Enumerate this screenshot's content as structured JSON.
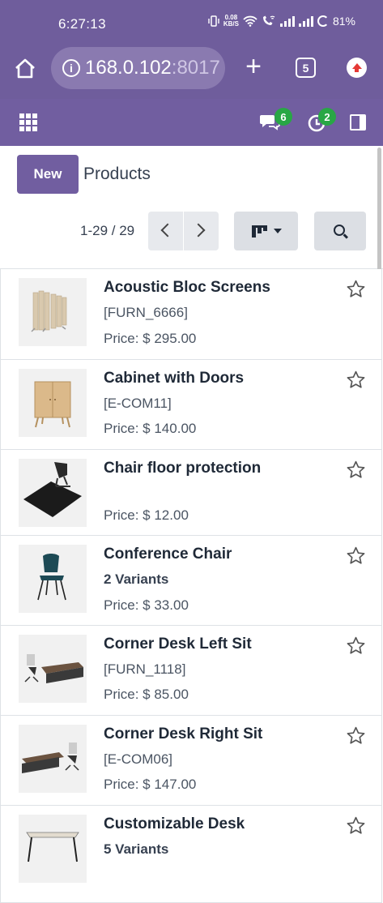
{
  "status_bar": {
    "time": "6:27:13",
    "net_speed_top": "0.08",
    "net_speed_unit": "KB/S",
    "battery": "81%"
  },
  "browser": {
    "url_host": "168.0.102",
    "url_port": ":8017",
    "tab_count": "5"
  },
  "app_bar": {
    "messages_count": "6",
    "activities_count": "2"
  },
  "control_panel": {
    "new_label": "New",
    "breadcrumb": "Products",
    "pager_value": "1-29 / 29"
  },
  "products": [
    {
      "name": "Acoustic Bloc Screens",
      "reference": "[FURN_6666]",
      "variants": "",
      "price": "Price: $ 295.00",
      "image": "screens"
    },
    {
      "name": "Cabinet with Doors",
      "reference": "[E-COM11]",
      "variants": "",
      "price": "Price: $ 140.00",
      "image": "cabinet"
    },
    {
      "name": "Chair floor protection",
      "reference": "",
      "variants": "",
      "price": "Price: $ 12.00",
      "image": "floormat"
    },
    {
      "name": "Conference Chair",
      "reference": "",
      "variants": "2 Variants",
      "price": "Price: $ 33.00",
      "image": "chair"
    },
    {
      "name": "Corner Desk Left Sit",
      "reference": "[FURN_1118]",
      "variants": "",
      "price": "Price: $ 85.00",
      "image": "desk-left"
    },
    {
      "name": "Corner Desk Right Sit",
      "reference": "[E-COM06]",
      "variants": "",
      "price": "Price: $ 147.00",
      "image": "desk-right"
    },
    {
      "name": "Customizable Desk",
      "reference": "",
      "variants": "5 Variants",
      "price": "",
      "image": "custom-desk"
    }
  ],
  "colors": {
    "brand": "#715ea0",
    "status_bar": "#6f5d9c",
    "badge": "#28a745"
  },
  "icons": [
    "home-icon",
    "info-icon",
    "plus-icon",
    "tabs-icon",
    "update-icon",
    "apps-icon",
    "chat-icon",
    "activity-icon",
    "panel-icon",
    "chevron-left-icon",
    "chevron-right-icon",
    "kanban-icon",
    "caret-down-icon",
    "search-icon",
    "star-icon"
  ]
}
